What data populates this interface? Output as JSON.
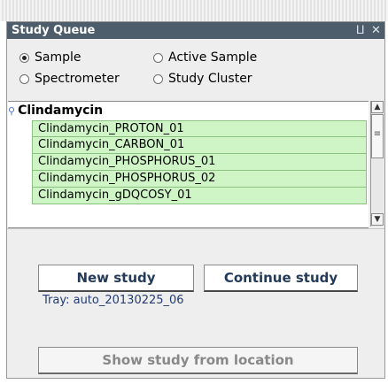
{
  "panel": {
    "title": "Study Queue"
  },
  "radios": [
    {
      "label": "Sample",
      "selected": true
    },
    {
      "label": "Active Sample",
      "selected": false
    },
    {
      "label": "Spectrometer",
      "selected": false
    },
    {
      "label": "Study Cluster",
      "selected": false
    }
  ],
  "tree": {
    "root": "Clindamycin",
    "items": [
      "Clindamycin_PROTON_01",
      "Clindamycin_CARBON_01",
      "Clindamycin_PHOSPHORUS_01",
      "Clindamycin_PHOSPHORUS_02",
      "Clindamycin_gDQCOSY_01"
    ]
  },
  "buttons": {
    "new_study": "New study",
    "continue_study": "Continue study",
    "show_from_location": "Show study from location"
  },
  "tray_text": "Tray: auto_20130225_06",
  "colors": {
    "titlebar": "#4d5d6b",
    "row_bg": "#cff5c7"
  }
}
